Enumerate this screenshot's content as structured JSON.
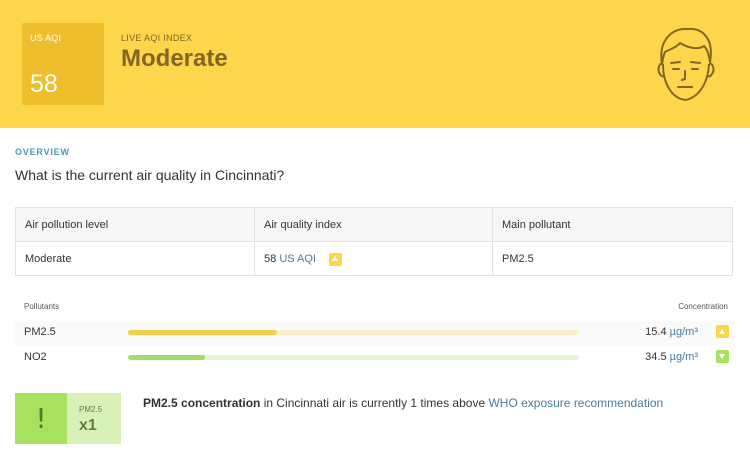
{
  "header": {
    "aqi_label": "US AQI",
    "aqi_value": "58",
    "subtitle": "LIVE AQI INDEX",
    "status": "Moderate"
  },
  "overview": {
    "label": "OVERVIEW",
    "question": "What is the current air quality in Cincinnati?"
  },
  "summary_table": {
    "headers": [
      "Air pollution level",
      "Air quality index",
      "Main pollutant"
    ],
    "level": "Moderate",
    "index_value": "58",
    "index_unit": "US AQI",
    "main_pollutant": "PM2.5"
  },
  "pollutants": {
    "header_left": "Pollutants",
    "header_right": "Concentration",
    "items": [
      {
        "name": "PM2.5",
        "value": "15.4",
        "unit": "µg/m³",
        "level": 0.33,
        "trend": "up",
        "bar_color": "#f4cf4c",
        "track_color": "#fbefc9"
      },
      {
        "name": "NO2",
        "value": "34.5",
        "unit": "µg/m³",
        "level": 0.17,
        "trend": "down",
        "bar_color": "#a3de64",
        "track_color": "#e9f5d8"
      }
    ]
  },
  "exposure": {
    "mark": "!",
    "pollutant": "PM2.5",
    "multiplier": "x1",
    "text_strong": "PM2.5 concentration",
    "text_middle": " in Cincinnati air is currently 1 times above ",
    "text_link": "WHO exposure recommendation"
  },
  "colors": {
    "hero": "#fdd64b",
    "aqi_box": "#efbe2d",
    "accent_text": "#826724",
    "good": "#a8e05f",
    "link": "#4a7a9e"
  }
}
